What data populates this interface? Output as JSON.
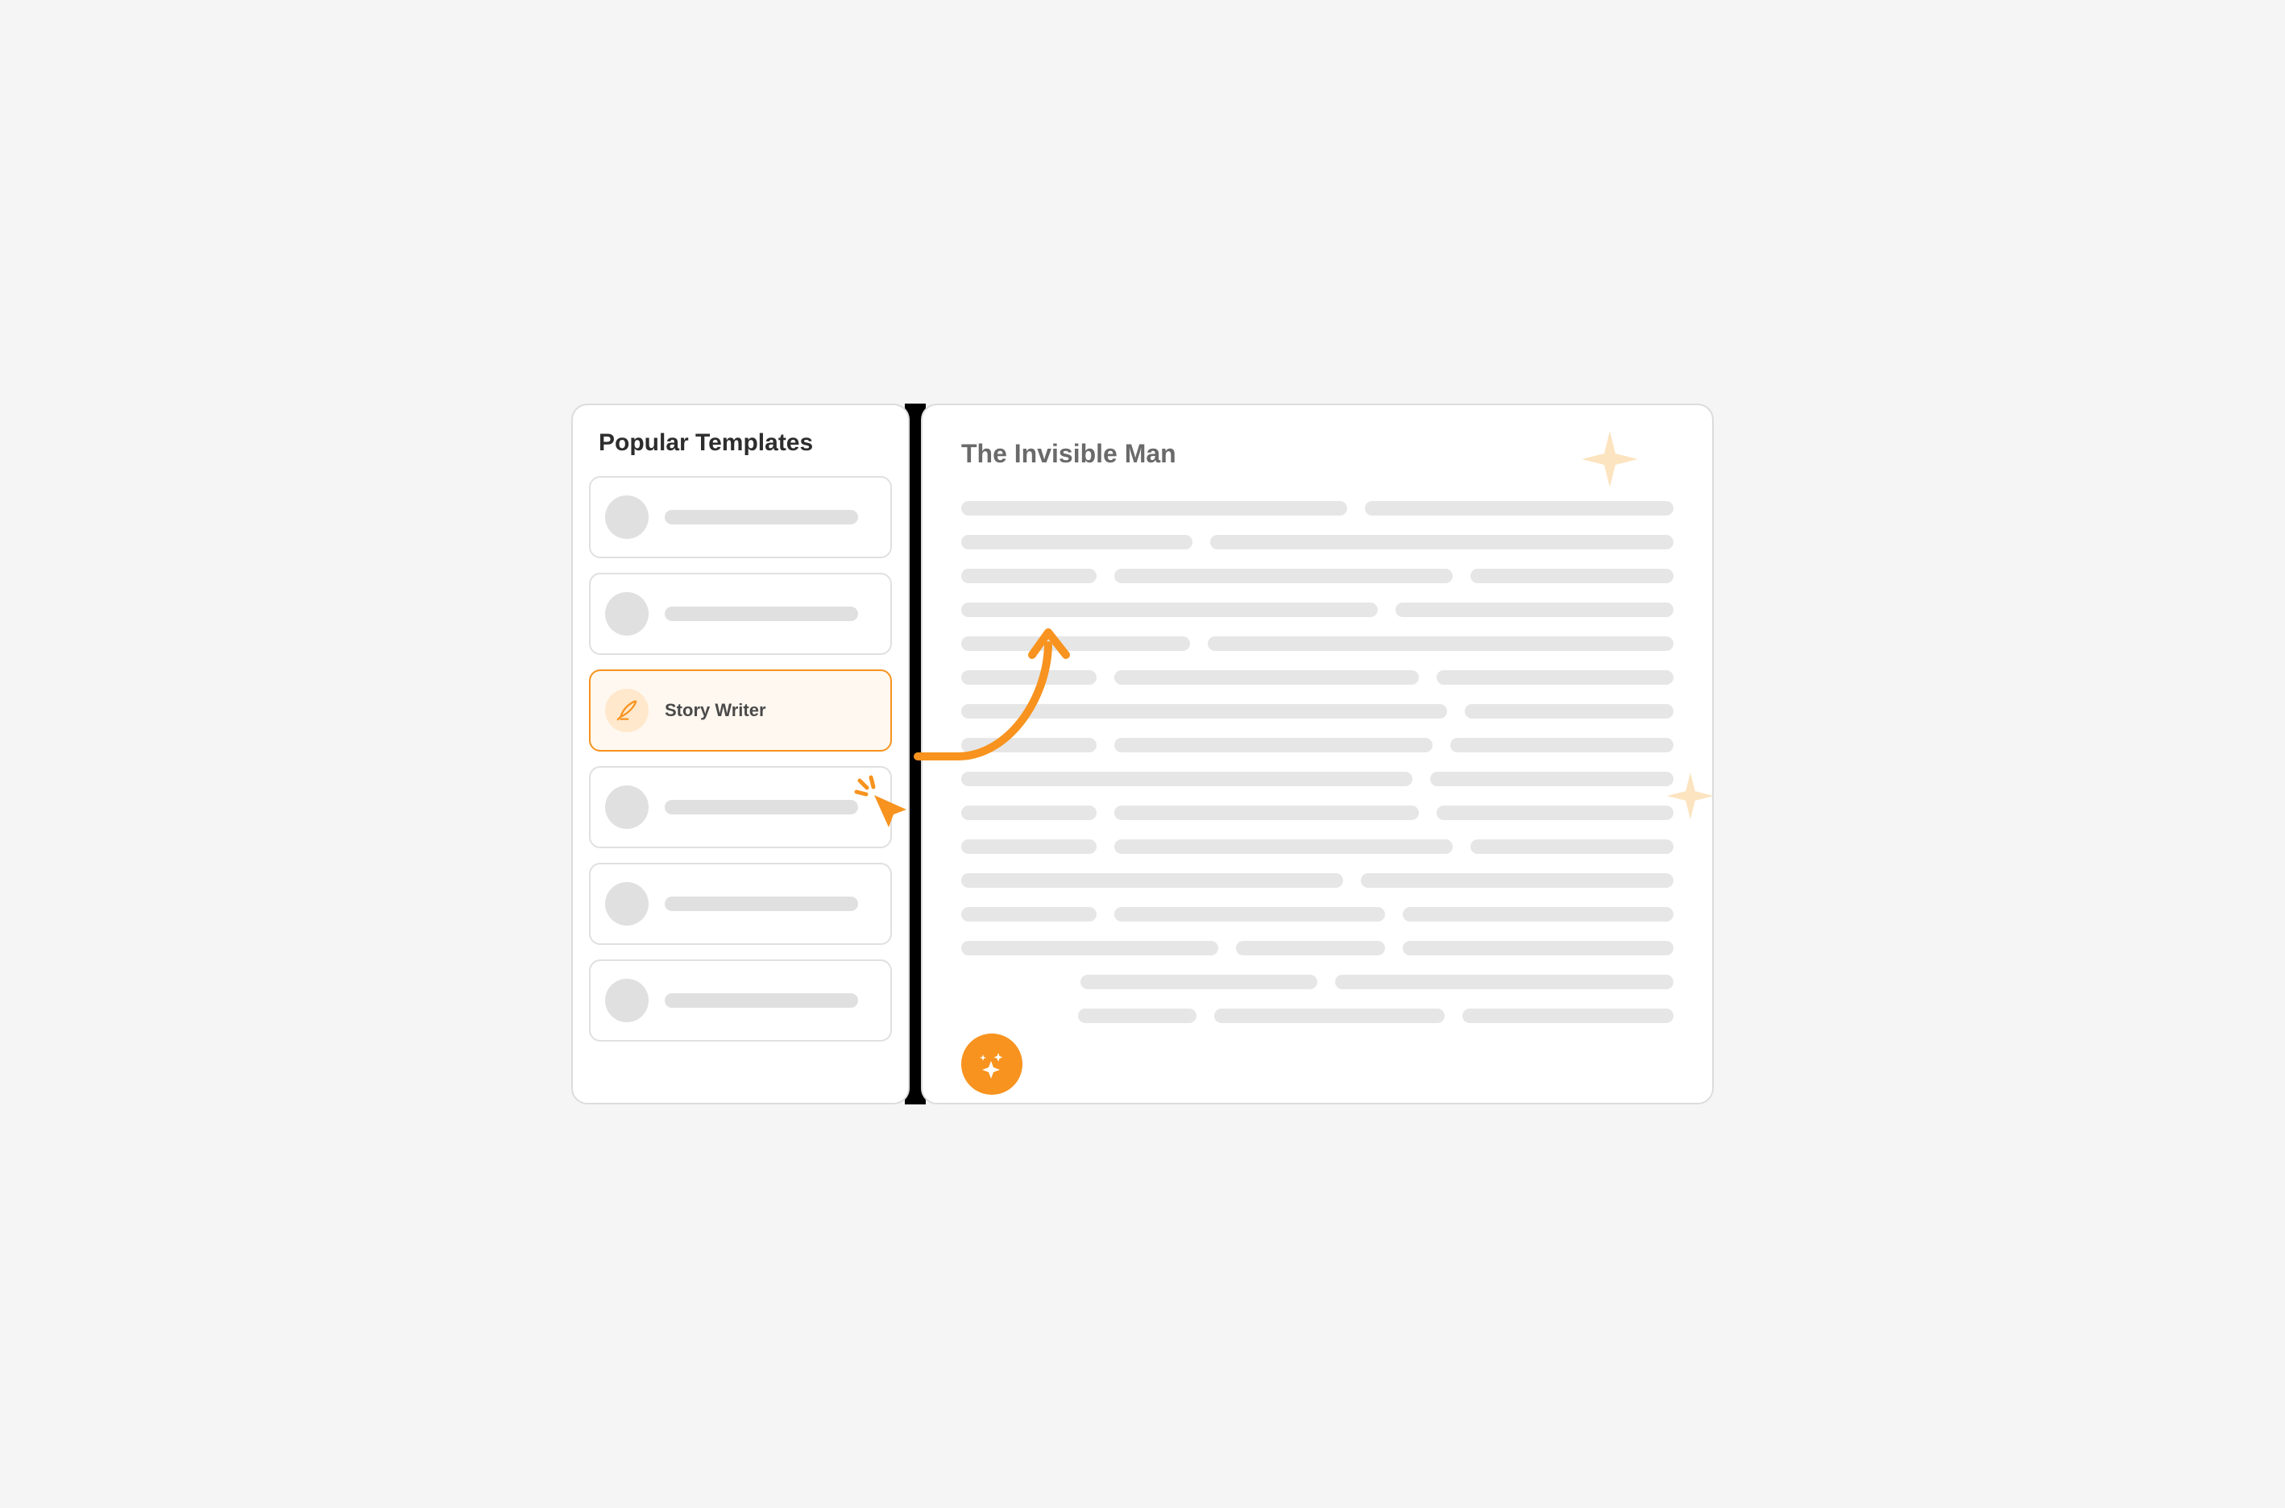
{
  "sidebar": {
    "title": "Popular Templates",
    "selected_template": {
      "label": "Story Writer",
      "icon": "quill-icon"
    }
  },
  "document": {
    "title": "The Invisible Man"
  },
  "icons": {
    "cursor": "cursor-click-icon",
    "quill": "quill-icon",
    "sparkle": "sparkle-icon",
    "star": "star-icon",
    "arrow": "curved-arrow-icon"
  },
  "colors": {
    "accent": "#f7931e",
    "accent_light": "#ffe8cc",
    "star_light": "#fce4c0",
    "text_dark": "#2d2d2d",
    "text_muted": "#6a6a6a",
    "placeholder": "#e0e0e0",
    "border": "#dcdcdc"
  }
}
